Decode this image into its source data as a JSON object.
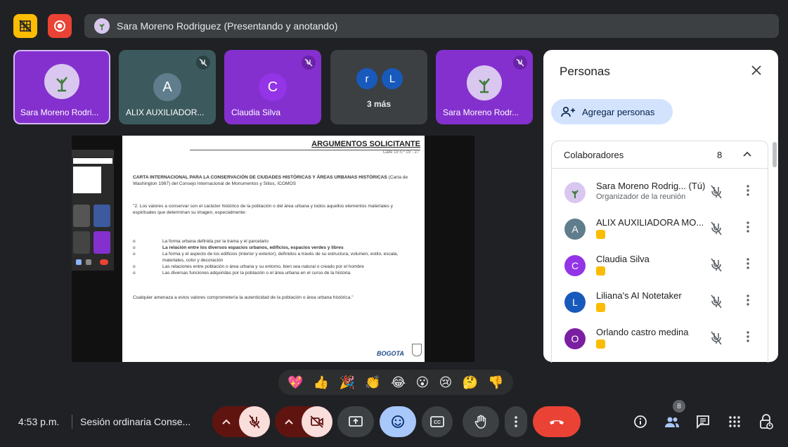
{
  "presenter_bar": {
    "text": "Sara Moreno Rodriguez (Presentando y anotando)"
  },
  "tiles": [
    {
      "name": "Sara Moreno Rodri...",
      "initial": ""
    },
    {
      "name": "ALIX AUXILIADOR...",
      "initial": "A"
    },
    {
      "name": "Claudia Silva",
      "initial": "C"
    },
    {
      "name": "3 más",
      "initials": [
        "r",
        "L"
      ]
    },
    {
      "name": "Sara Moreno Rodr...",
      "initial": ""
    }
  ],
  "document": {
    "header": "ARGUMENTOS SOLICITANTE",
    "address": "Calle 19 n.º 19 - 27",
    "title_bold": "CARTA INTERNACIONAL PARA LA CONSERVACIÓN DE CIUDADES HISTÓRICAS Y ÁREAS URBANAS HISTÓRICAS",
    "title_rest": " (Carta de Washington 1987) del Consejo Internacional de Monumentos y Sitios, ICOMOS",
    "quote": "\"2. Los valores a conservar son el carácter histórico de la población o del área urbana y todos aquellos elementos materiales y espirituales que determinan su imagen, especialmente:",
    "bullets": [
      "La forma urbana definida por la trama y el parcelario",
      "La relación entre los diversos espacios urbanos, edificios, espacios verdes y libres",
      "La forma y el aspecto de los edificios (interior y exterior), definidos a través de su estructura, volumen, estilo, escala, materiales, color y decoración",
      "Las relaciones entre población o área urbana y su entorno, bien sea natural o creado por el hombre",
      "Las diversas funciones adquiridas por la población o el área urbana en el curso de la historia."
    ],
    "closing": "Cualquier amenaza a estos valores comprometería la autenticidad de la población o área urbana histórica.\"",
    "logo": "BOGOTA"
  },
  "panel": {
    "title": "Personas",
    "add_label": "Agregar personas",
    "section_label": "Colaboradores",
    "count": "8",
    "people": [
      {
        "name": "Sara Moreno Rodrig... (Tú)",
        "sub": "Organizador de la reunión",
        "initial": "",
        "color": "#d9c7ef"
      },
      {
        "name": "ALIX AUXILIADORA MO...",
        "initial": "A",
        "color": "#5f7d8c"
      },
      {
        "name": "Claudia Silva",
        "initial": "C",
        "color": "#9334e6"
      },
      {
        "name": "Liliana's AI Notetaker",
        "initial": "L",
        "color": "#185abc"
      },
      {
        "name": "Orlando castro medina",
        "initial": "O",
        "color": "#7b1fa2"
      }
    ]
  },
  "reactions": [
    "💖",
    "👍",
    "🎉",
    "👏",
    "😂",
    "😮",
    "😢",
    "🤔",
    "👎"
  ],
  "bottom": {
    "time": "4:53 p.m.",
    "meeting": "Sesión ordinaria Conse...",
    "people_badge": "8"
  },
  "colors": {
    "end_call": "#ea4335",
    "accent": "#8ab4f8",
    "tile_purple": "#8430ce",
    "tile_teal": "#3c5a5d"
  }
}
